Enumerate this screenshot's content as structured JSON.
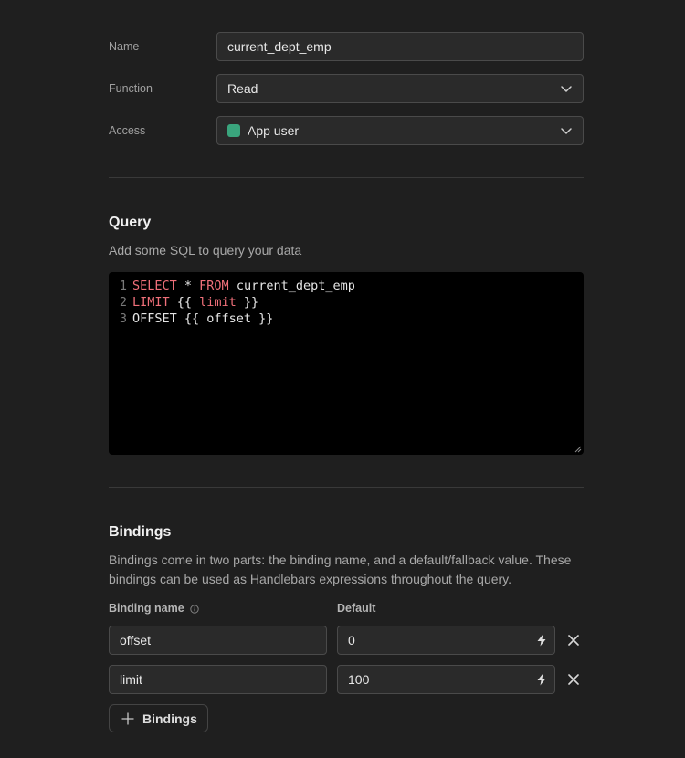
{
  "form": {
    "name_label": "Name",
    "name_value": "current_dept_emp",
    "function_label": "Function",
    "function_value": "Read",
    "access_label": "Access",
    "access_value": "App user",
    "access_color": "#3aa57d"
  },
  "query": {
    "title": "Query",
    "description": "Add some SQL to query your data",
    "lines": [
      {
        "num": "1",
        "segments": [
          {
            "t": "SELECT",
            "kw": true
          },
          {
            "t": " * ",
            "kw": false
          },
          {
            "t": "FROM",
            "kw": true
          },
          {
            "t": " current_dept_emp",
            "kw": false
          }
        ]
      },
      {
        "num": "2",
        "segments": [
          {
            "t": "LIMIT",
            "kw": true
          },
          {
            "t": " {{ ",
            "kw": false
          },
          {
            "t": "limit",
            "kw": true
          },
          {
            "t": " }}",
            "kw": false
          }
        ]
      },
      {
        "num": "3",
        "segments": [
          {
            "t": "OFFSET {{ offset }}",
            "kw": false
          }
        ]
      }
    ]
  },
  "bindings": {
    "title": "Bindings",
    "description": "Bindings come in two parts: the binding name, and a default/fallback value. These bindings can be used as Handlebars expressions throughout the query.",
    "col_name": "Binding name",
    "col_default": "Default",
    "rows": [
      {
        "name": "offset",
        "default": "0"
      },
      {
        "name": "limit",
        "default": "100"
      }
    ],
    "add_label": "Bindings"
  }
}
